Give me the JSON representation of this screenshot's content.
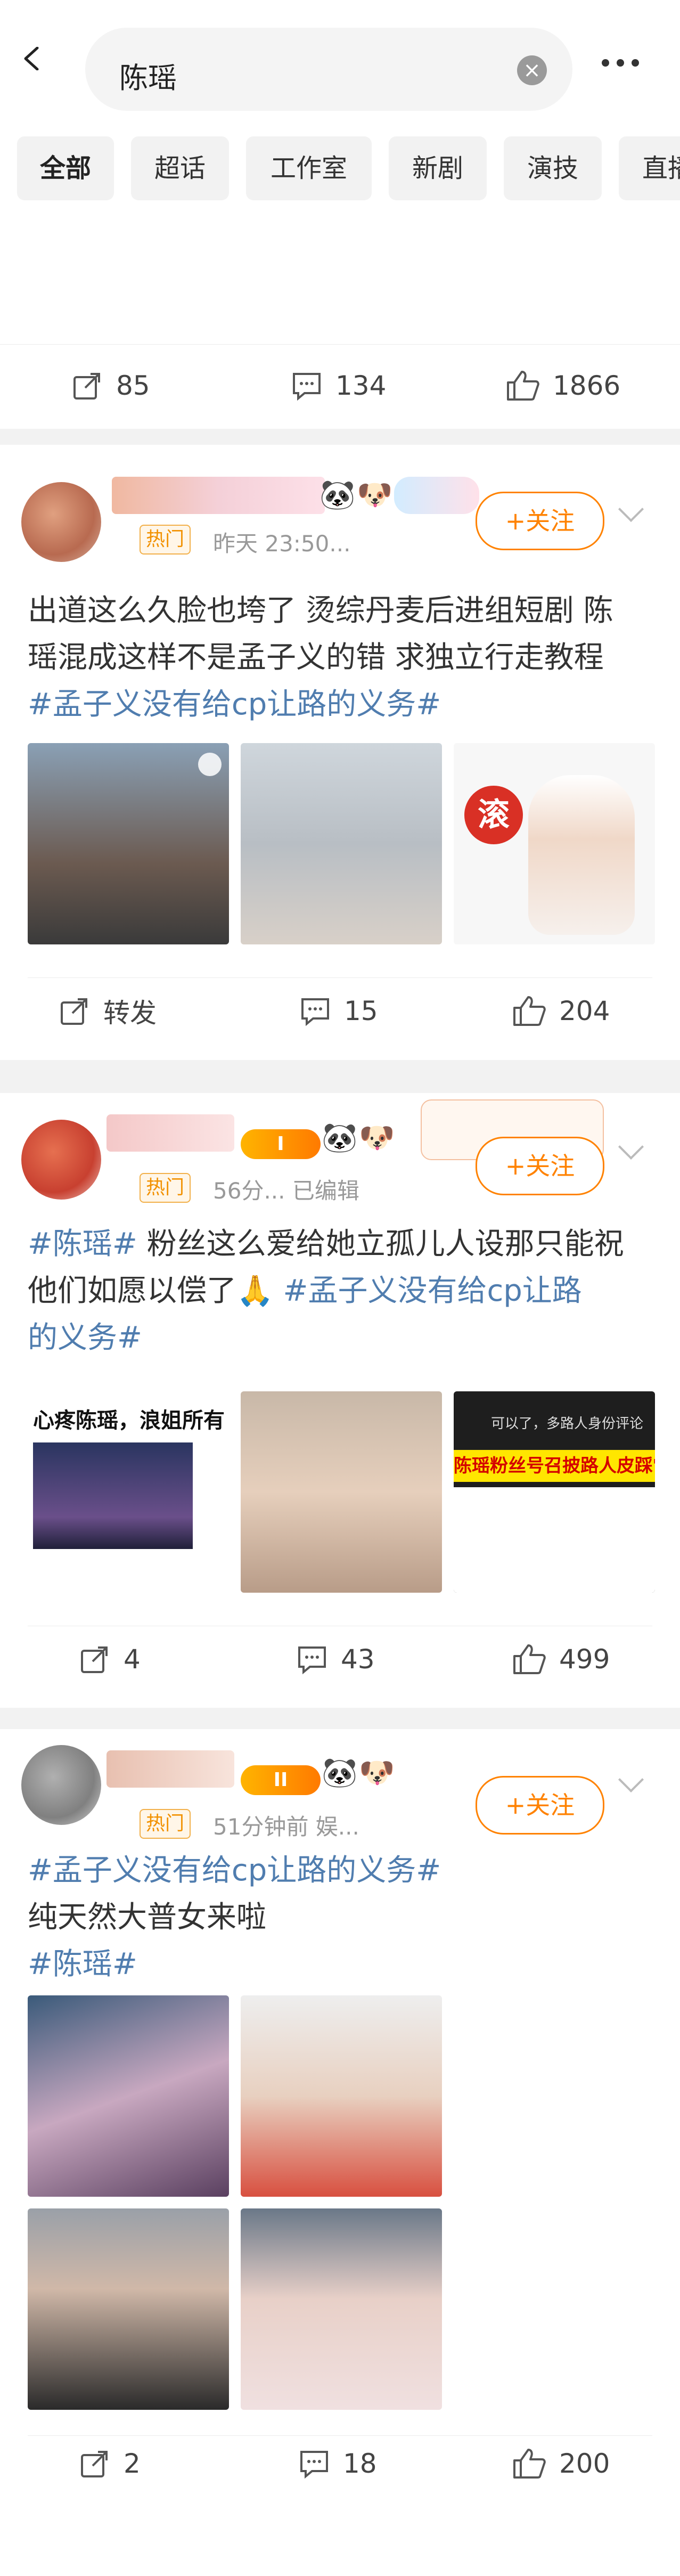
{
  "search": {
    "query": "陈瑶",
    "clear_icon": "clear-icon"
  },
  "tabs": [
    "全部",
    "超话",
    "工作室",
    "新剧",
    "演技",
    "直播"
  ],
  "prev_post": {
    "repost": "85",
    "comment": "134",
    "like": "1866"
  },
  "posts": [
    {
      "hot_label": "热门",
      "time": "昨天 23:50...",
      "follow": "+关注",
      "text_line1": "出道这么久脸也垮了 烫综丹麦后进组短剧 陈",
      "text_line2": "瑶混成这样不是孟子义的错 求独立行走教程",
      "tag1": "#孟子义没有给cp让路的义务#",
      "sticker_text": "滚",
      "repost": "转发",
      "comment": "15",
      "like": "204"
    },
    {
      "hot_label": "热门",
      "level": "I",
      "time": "56分... 已编辑",
      "follow": "+关注",
      "tag_a": "#陈瑶#",
      "text_a": " 粉丝这么爱给她立孤儿人设那只能祝",
      "text_b": "他们如愿以偿了🙏 ",
      "tag_b1": "#孟子义没有给cp让路",
      "tag_b2": "的义务#",
      "img1_caption": "心疼陈瑶，浪姐所有",
      "img3_line1": "可以了，多路人身份评论",
      "img3_banner": "陈瑶粉丝号召披路人皮踩常驻",
      "repost": "4",
      "comment": "43",
      "like": "499"
    },
    {
      "hot_label": "热门",
      "level": "II",
      "time": "51分钟前 娱...",
      "follow": "+关注",
      "tag1": "#孟子义没有给cp让路的义务#",
      "line2": "纯天然大普女来啦",
      "tag2": "#陈瑶#",
      "repost": "2",
      "comment": "18",
      "like": "200"
    }
  ],
  "icons": [
    "back-icon",
    "more-icon",
    "repost-icon",
    "comment-icon",
    "like-icon",
    "panda-icon",
    "dog-icon"
  ],
  "colors": {
    "accent": "#ff8200",
    "link": "#507daf",
    "hot": "#f29100"
  }
}
